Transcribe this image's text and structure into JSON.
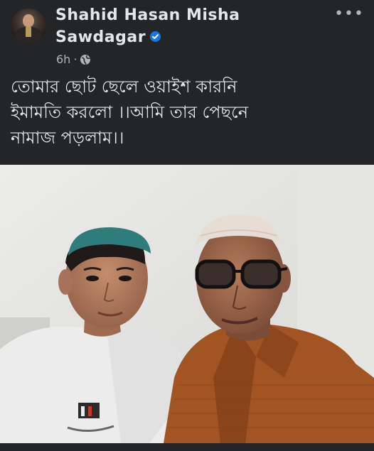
{
  "post": {
    "author": "Shahid Hasan Misha Sawdagar",
    "timestamp": "6h",
    "caption": "তোমার ছোট ছেলে ওয়াইশ কারনি\nইমামতি করলো ।।আমি তার পেছনে\nনামাজ পড়লাম।।"
  },
  "icons": {
    "verified": "verified-badge-icon",
    "privacy": "globe-icon",
    "more": "more-options-icon"
  },
  "colors": {
    "background": "#242526",
    "text": "#e4e6eb",
    "secondary_text": "#b0b3b8",
    "verified_blue": "#1b74e4"
  }
}
